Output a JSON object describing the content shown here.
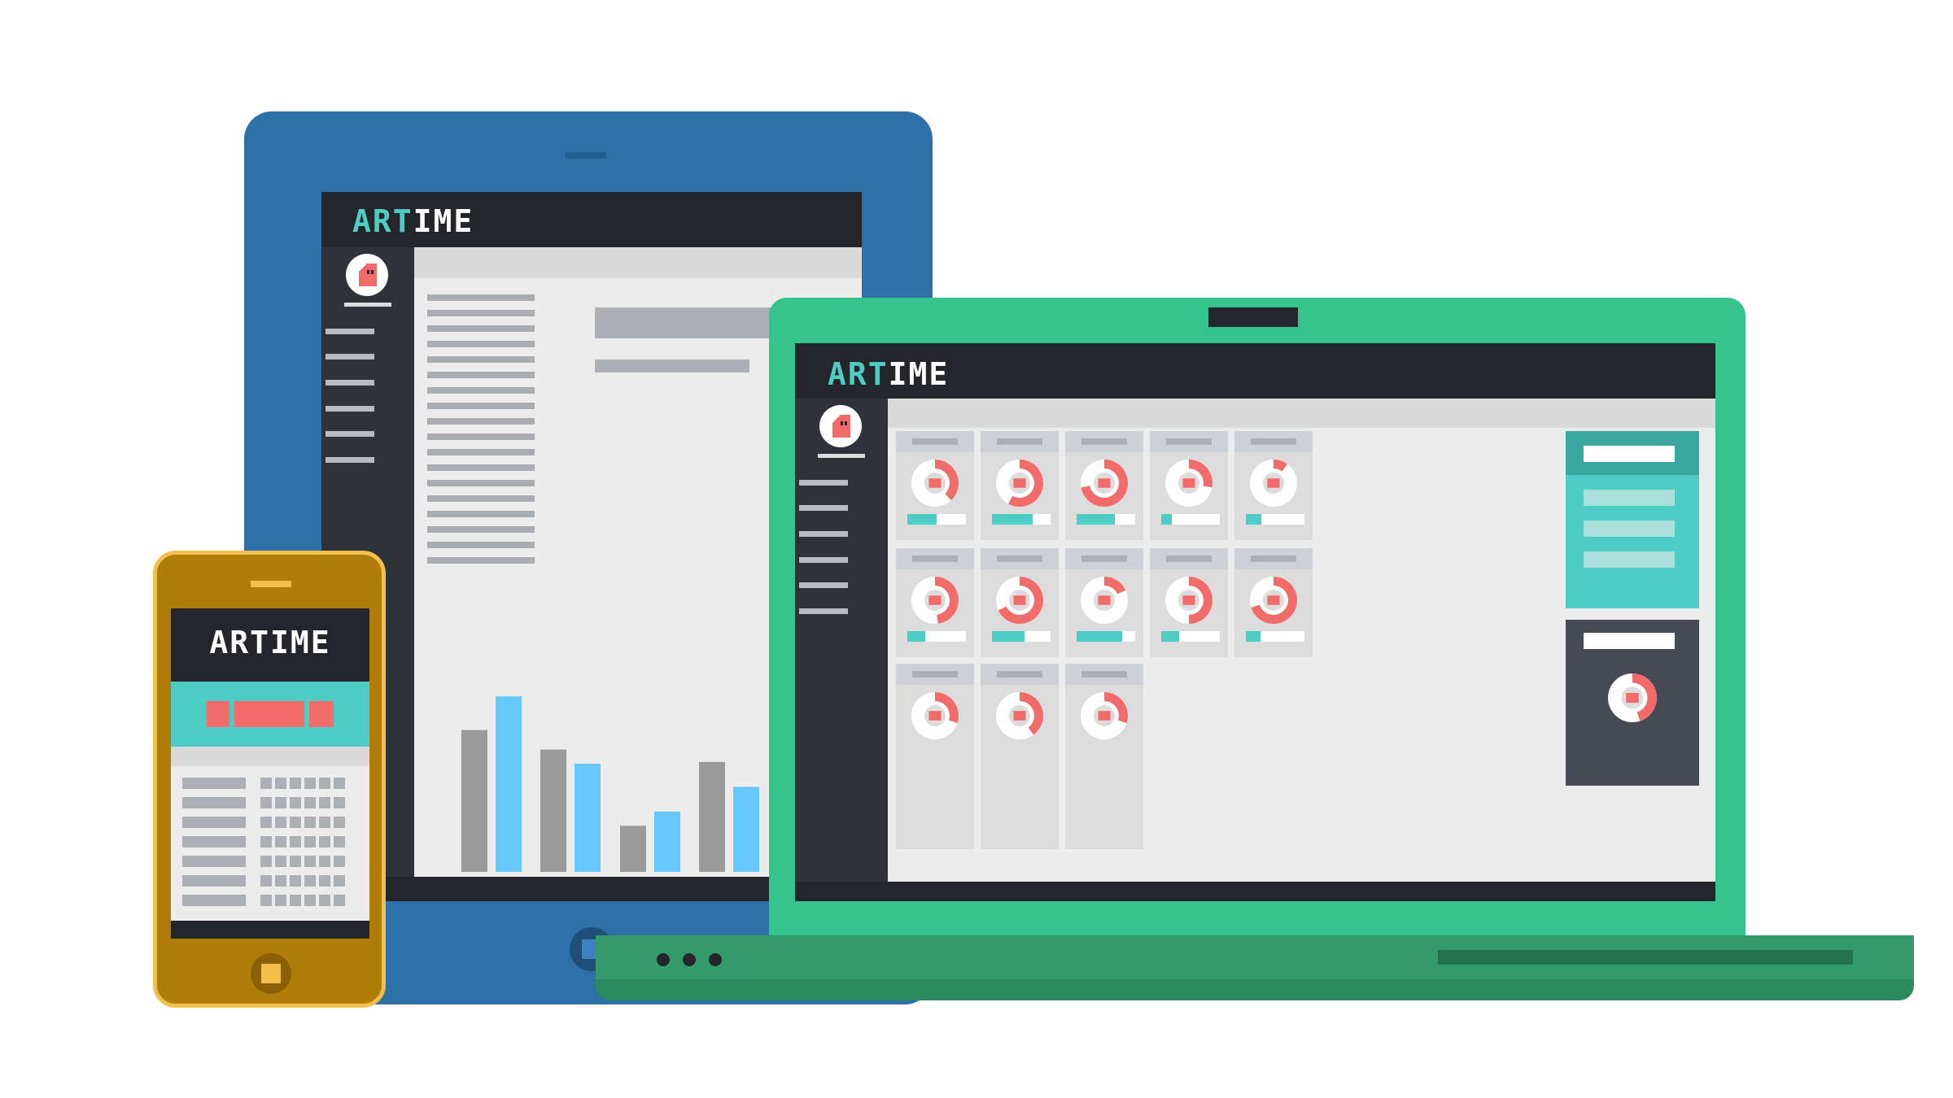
{
  "brand": {
    "accent_part": "ART",
    "rest_part": "IME",
    "full": "ARTIME"
  },
  "colors": {
    "tablet_body": "#2d71a8",
    "laptop_body": "#35c48d",
    "laptop_base": "#2c8a60",
    "phone_body": "#b07c0a",
    "phone_rim": "#f2c04a",
    "screen_dark": "#25262b",
    "sidebar": "#30323a",
    "content_bg": "#ececec",
    "teal": "#4ecdc4",
    "coral": "#f26b6b",
    "bar_gray": "#9a9a9a",
    "bar_blue": "#66c8fb"
  },
  "icons": {
    "avatar": "avatar-icon",
    "home_button": "home-button-icon",
    "donut": "donut-chart-icon"
  },
  "tablet_chart": {
    "type": "bar",
    "series": [
      {
        "values": [
          0.8,
          0.69,
          0.26,
          0.62
        ]
      },
      {
        "values": [
          0.99,
          0.61,
          0.34,
          0.48
        ]
      }
    ]
  },
  "laptop_cards": [
    {
      "donut": 0.38,
      "progress": 0.5
    },
    {
      "donut": 0.58,
      "progress": 0.7
    },
    {
      "donut": 0.72,
      "progress": 0.65
    },
    {
      "donut": 0.28,
      "progress": 0.18
    },
    {
      "donut": 0.1,
      "progress": 0.27
    },
    {
      "donut": 0.48,
      "progress": 0.3
    },
    {
      "donut": 0.68,
      "progress": 0.55
    },
    {
      "donut": 0.18,
      "progress": 0.78
    },
    {
      "donut": 0.5,
      "progress": 0.3
    },
    {
      "donut": 0.7,
      "progress": 0.25
    },
    {
      "donut": 0.3,
      "progress": 0
    },
    {
      "donut": 0.4,
      "progress": 0
    },
    {
      "donut": 0.3,
      "progress": 0
    }
  ],
  "summary_donut": 0.45
}
